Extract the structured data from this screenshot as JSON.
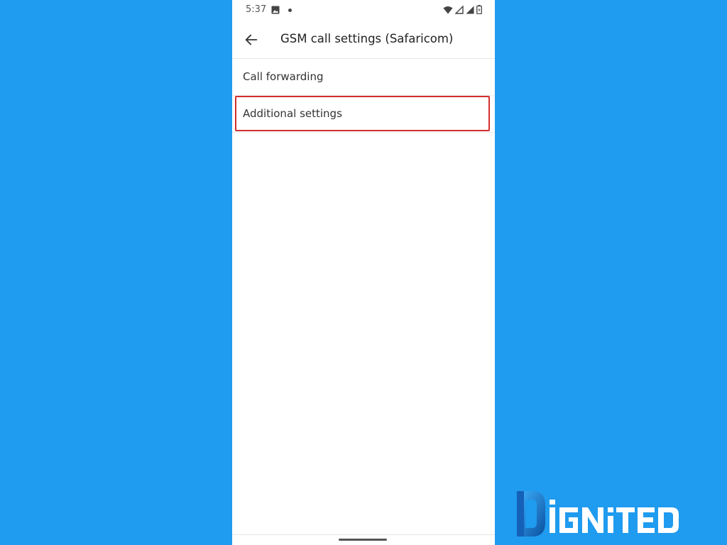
{
  "status_bar": {
    "time": "5:37",
    "icons": [
      "image-icon",
      "notification-dot-icon",
      "wifi-icon",
      "signal-empty-icon",
      "signal-icon",
      "battery-icon"
    ]
  },
  "app_bar": {
    "title": "GSM call settings (Safaricom)",
    "back_icon": "arrow-left-icon"
  },
  "settings": {
    "items": [
      {
        "label": "Call forwarding"
      },
      {
        "label": "Additional settings",
        "highlighted": true
      }
    ]
  },
  "annotation": {
    "highlight_color": "#d32f2f"
  },
  "colors": {
    "background": "#1f9bef",
    "screen": "#ffffff"
  },
  "watermark": {
    "logo_text": "DIGNITED"
  }
}
